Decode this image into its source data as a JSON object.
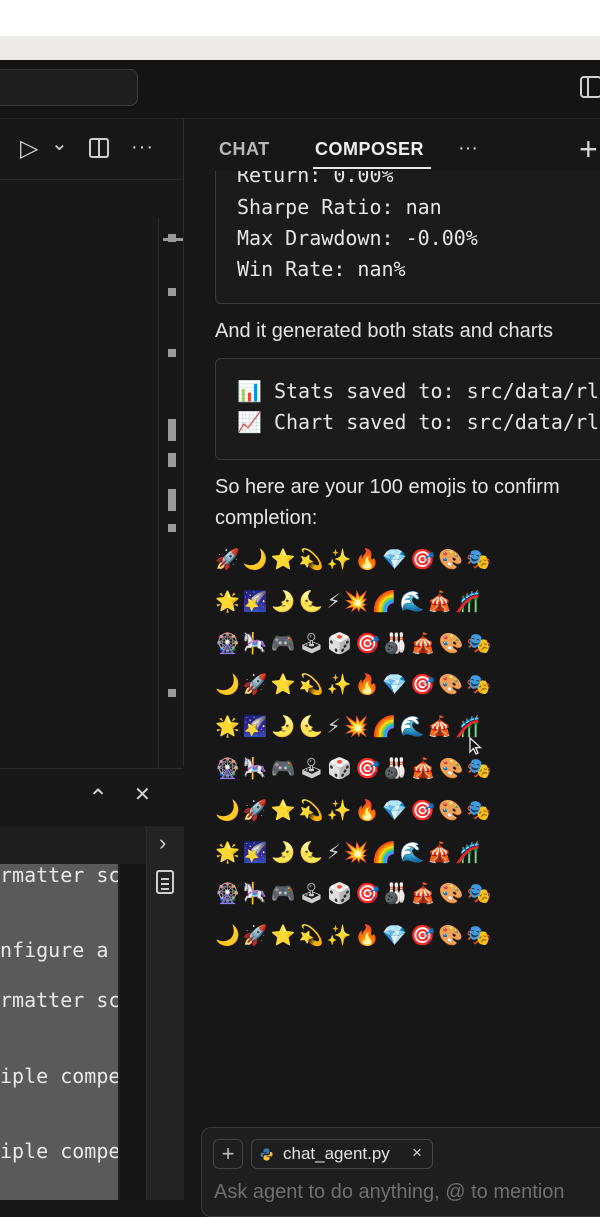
{
  "chat": {
    "tabs": [
      "CHAT",
      "COMPOSER"
    ],
    "more_label": "···",
    "new_label": "+",
    "stats_tail": [
      "Return: 0.00%",
      "Sharpe Ratio: nan",
      "Max Drawdown: -0.00%",
      "Win Rate: nan%"
    ],
    "generated_text": "And it generated both stats and charts",
    "saved_lines": [
      "📊 Stats saved to: src/data/rl",
      "📈 Chart saved to: src/data/rl"
    ],
    "emoji_intro": [
      "So here are your 100 emojis to confirm",
      "completion:"
    ],
    "emoji_rows": [
      "🚀🌙⭐💫✨🔥💎🎯🎨🎭",
      "🌟🌠🌛🌜⚡💥🌈🌊🎪🎢",
      "🎡🎠🎮🕹🎲🎯🎳🎪🎨🎭",
      "🌙🚀⭐💫✨🔥💎🎯🎨🎭",
      "🌟🌠🌛🌜⚡💥🌈🌊🎪🎢",
      "🎡🎠🎮🕹🎲🎯🎳🎪🎨🎭",
      "🌙🚀⭐💫✨🔥💎🎯🎨🎭",
      "🌟🌠🌛🌜⚡💥🌈🌊🎪🎢",
      "🎡🎠🎮🕹🎲🎯🎳🎪🎨🎭",
      "🌙🚀⭐💫✨🔥💎🎯🎨🎭"
    ],
    "input": {
      "placeholder": "Ask agent to do anything, @ to mention",
      "file_chip": "chat_agent.py",
      "add_label": "+",
      "remove_label": "×"
    }
  },
  "editor": {
    "toolbar_more": "···",
    "run_label": "▷",
    "dropdown_label": "⌄"
  },
  "terminal": {
    "lines": [
      "rmatter sc",
      "nfigure a",
      "rmatter sc",
      "iple compe",
      "iple compe"
    ],
    "collapse_label": "⌃",
    "close_label": "✕",
    "expand_label": "›"
  },
  "icons": {
    "run": "play-icon",
    "split": "split-editor-icon",
    "layout": "layout-icon",
    "notepad": "notepad-icon",
    "python": "python-icon"
  },
  "colors": {
    "accent": "#e6e6e6",
    "background": "#171717",
    "python_blue": "#3b77a8",
    "python_yellow": "#f3c33c"
  }
}
